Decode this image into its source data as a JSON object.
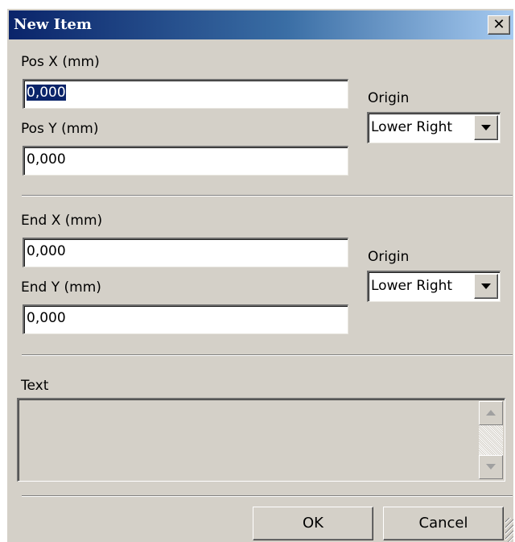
{
  "window": {
    "title": "New Item",
    "close_glyph": "✕"
  },
  "position": {
    "pos_x_label": "Pos X (mm)",
    "pos_x_value": "0,000",
    "pos_y_label": "Pos Y (mm)",
    "pos_y_value": "0,000",
    "origin_label": "Origin",
    "origin_value": "Lower Right"
  },
  "end": {
    "end_x_label": "End X (mm)",
    "end_x_value": "0,000",
    "end_y_label": "End Y (mm)",
    "end_y_value": "0,000",
    "origin_label": "Origin",
    "origin_value": "Lower Right"
  },
  "text": {
    "label": "Text",
    "value": ""
  },
  "buttons": {
    "ok": "OK",
    "cancel": "Cancel"
  },
  "colors": {
    "titlebar_start": "#0a246a",
    "titlebar_end": "#a6caf0",
    "face": "#d4d0c8",
    "selection": "#0a246a"
  }
}
